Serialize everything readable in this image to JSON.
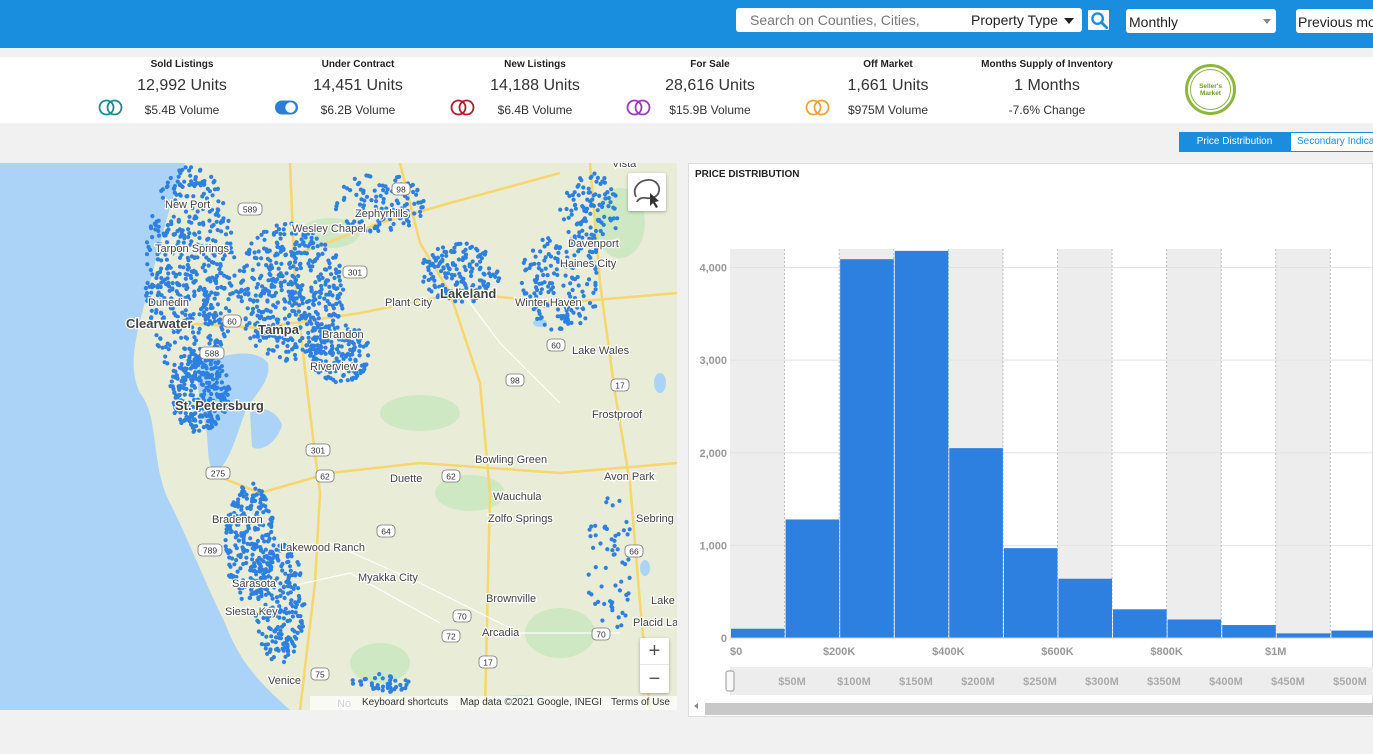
{
  "header": {
    "search_placeholder": "Search on Counties, Cities,",
    "property_type": "Property Type",
    "period_select": "Monthly",
    "previous_select": "Previous mo"
  },
  "stats": [
    {
      "label": "Sold Listings",
      "value": "12,992 Units",
      "sub": "$5.4B Volume",
      "color": "#1c8c8c"
    },
    {
      "label": "Under Contract",
      "value": "14,451 Units",
      "sub": "$6.2B Volume",
      "color": "#2a7fd4"
    },
    {
      "label": "New Listings",
      "value": "14,188 Units",
      "sub": "$6.4B Volume",
      "color": "#b01c2e"
    },
    {
      "label": "For Sale",
      "value": "28,616 Units",
      "sub": "$15.9B Volume",
      "color": "#9b3bb5"
    },
    {
      "label": "Off Market",
      "value": "1,661 Units",
      "sub": "$975M Volume",
      "color": "#e8a33a"
    },
    {
      "label": "Months Supply of Inventory",
      "value": "1 Months",
      "sub": "-7.6% Change"
    }
  ],
  "badge": {
    "line1": "Seller's",
    "line2": "Market"
  },
  "tabs": {
    "active": "Price Distribution",
    "inactive": "Secondary Indica"
  },
  "map": {
    "places": [
      {
        "name": "New Port",
        "x": 165,
        "y": 204
      },
      {
        "name": "Zephyrhills",
        "x": 355,
        "y": 213
      },
      {
        "name": "Wesley Chapel",
        "x": 292,
        "y": 228
      },
      {
        "name": "Davenport",
        "x": 568,
        "y": 243
      },
      {
        "name": "Haines City",
        "x": 560,
        "y": 263
      },
      {
        "name": "Tarpon Springs",
        "x": 155,
        "y": 248
      },
      {
        "name": "Dunedin",
        "x": 148,
        "y": 302
      },
      {
        "name": "Plant City",
        "x": 385,
        "y": 302
      },
      {
        "name": "Lakeland",
        "x": 440,
        "y": 294
      },
      {
        "name": "Winter Haven",
        "x": 515,
        "y": 302
      },
      {
        "name": "Clearwater",
        "x": 126,
        "y": 324
      },
      {
        "name": "Tampa",
        "x": 258,
        "y": 330
      },
      {
        "name": "Brandon",
        "x": 322,
        "y": 334
      },
      {
        "name": "Lake Wales",
        "x": 572,
        "y": 350
      },
      {
        "name": "Riverview",
        "x": 310,
        "y": 366
      },
      {
        "name": "St. Petersburg",
        "x": 175,
        "y": 406
      },
      {
        "name": "Frostproof",
        "x": 592,
        "y": 414
      },
      {
        "name": "Duette",
        "x": 390,
        "y": 478
      },
      {
        "name": "Bowling Green",
        "x": 475,
        "y": 459
      },
      {
        "name": "Avon Park",
        "x": 604,
        "y": 476
      },
      {
        "name": "Wauchula",
        "x": 493,
        "y": 496
      },
      {
        "name": "Zolfo Springs",
        "x": 488,
        "y": 518
      },
      {
        "name": "Sebring",
        "x": 636,
        "y": 518
      },
      {
        "name": "Bradenton",
        "x": 212,
        "y": 519
      },
      {
        "name": "Lakewood Ranch",
        "x": 280,
        "y": 547
      },
      {
        "name": "Myakka City",
        "x": 358,
        "y": 577
      },
      {
        "name": "Sarasota",
        "x": 232,
        "y": 583
      },
      {
        "name": "Brownville",
        "x": 486,
        "y": 598
      },
      {
        "name": "Lake",
        "x": 651,
        "y": 600
      },
      {
        "name": "Siesta Key",
        "x": 225,
        "y": 611
      },
      {
        "name": "Placid Lak",
        "x": 633,
        "y": 622
      },
      {
        "name": "Arcadia",
        "x": 482,
        "y": 632
      },
      {
        "name": "Venice",
        "x": 268,
        "y": 680
      },
      {
        "name": "Vista",
        "x": 612,
        "y": 163
      },
      {
        "name": "No",
        "x": 337,
        "y": 703
      }
    ],
    "shields": [
      {
        "label": "589",
        "x": 250,
        "y": 209
      },
      {
        "label": "98",
        "x": 401,
        "y": 189
      },
      {
        "label": "301",
        "x": 355,
        "y": 272
      },
      {
        "label": "60",
        "x": 232,
        "y": 321
      },
      {
        "label": "588",
        "x": 212,
        "y": 353
      },
      {
        "label": "60",
        "x": 556,
        "y": 345
      },
      {
        "label": "98",
        "x": 515,
        "y": 380
      },
      {
        "label": "17",
        "x": 620,
        "y": 385
      },
      {
        "label": "301",
        "x": 318,
        "y": 450
      },
      {
        "label": "62",
        "x": 325,
        "y": 476
      },
      {
        "label": "62",
        "x": 451,
        "y": 476
      },
      {
        "label": "64",
        "x": 386,
        "y": 531
      },
      {
        "label": "66",
        "x": 634,
        "y": 551
      },
      {
        "label": "70",
        "x": 462,
        "y": 616
      },
      {
        "label": "72",
        "x": 451,
        "y": 636
      },
      {
        "label": "70",
        "x": 601,
        "y": 634
      },
      {
        "label": "17",
        "x": 488,
        "y": 662
      },
      {
        "label": "275",
        "x": 218,
        "y": 473
      },
      {
        "label": "75",
        "x": 320,
        "y": 674
      },
      {
        "label": "789",
        "x": 210,
        "y": 550
      }
    ],
    "attribution": {
      "shortcuts": "Keyboard shortcuts",
      "data": "Map data ©2021 Google, INEGI",
      "terms": "Terms of Use"
    },
    "zoom_in": "+",
    "zoom_out": "−"
  },
  "chart_data": {
    "type": "bar",
    "title": "PRICE DISTRIBUTION",
    "bin_width": 100000,
    "x": [
      0,
      100000,
      200000,
      300000,
      400000,
      500000,
      600000,
      700000,
      800000,
      900000,
      1000000,
      1100000
    ],
    "values": [
      100,
      1280,
      4090,
      4180,
      2050,
      970,
      640,
      310,
      200,
      140,
      50,
      80
    ],
    "xlim": [
      0,
      1180000
    ],
    "ylim": [
      0,
      4200
    ],
    "y_ticks": [
      0,
      1000,
      2000,
      3000,
      4000
    ],
    "y_tick_labels": [
      "0",
      "1,000",
      "2,000",
      "3,000",
      "4,000"
    ],
    "x_ticks": [
      0,
      200000,
      400000,
      600000,
      800000,
      1000000,
      1200000
    ],
    "x_tick_labels": [
      "$0",
      "$200K",
      "$400K",
      "$600K",
      "$800K",
      "$1M",
      "$"
    ],
    "navigator_labels": [
      "$50M",
      "$100M",
      "$150M",
      "$200M",
      "$250M",
      "$300M",
      "$350M",
      "$400M",
      "$450M",
      "$500M"
    ],
    "color": "#2e80e0"
  }
}
